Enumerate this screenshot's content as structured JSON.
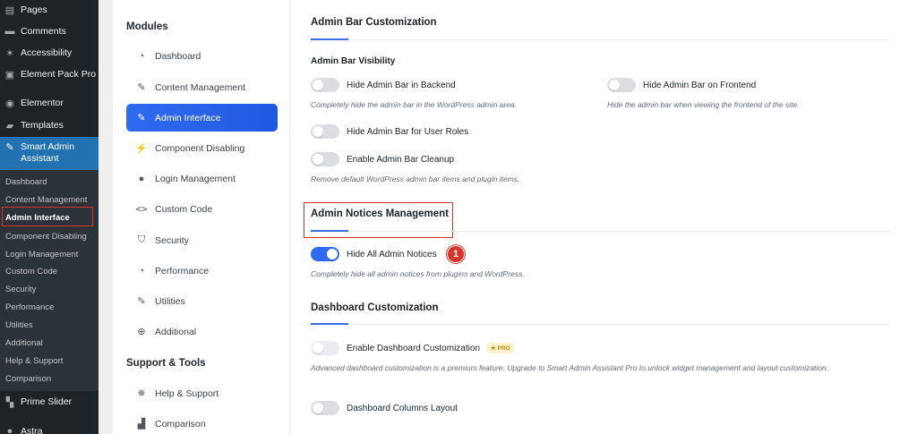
{
  "wp_menu": {
    "items": [
      {
        "label": "Pages",
        "icon": "pages-icon"
      },
      {
        "label": "Comments",
        "icon": "comments-icon"
      },
      {
        "label": "Accessibility",
        "icon": "accessibility-icon"
      },
      {
        "label": "Element Pack Pro",
        "icon": "element-pack-icon"
      },
      {
        "label": "Elementor",
        "icon": "elementor-icon"
      },
      {
        "label": "Templates",
        "icon": "folder-icon"
      },
      {
        "label": "Smart Admin Assistant",
        "icon": "wrench-icon"
      },
      {
        "label": "Prime Slider",
        "icon": "slider-icon"
      },
      {
        "label": "Astra",
        "icon": "astra-icon"
      }
    ],
    "submenu": [
      "Dashboard",
      "Content Management",
      "Admin Interface",
      "Component Disabling",
      "Login Management",
      "Custom Code",
      "Security",
      "Performance",
      "Utilities",
      "Additional",
      "Help & Support",
      "Comparison"
    ]
  },
  "modules_nav": {
    "modules_heading": "Modules",
    "modules": [
      {
        "label": "Dashboard",
        "icon": "dashboard-gauge-icon"
      },
      {
        "label": "Content Management",
        "icon": "pin-icon"
      },
      {
        "label": "Admin Interface",
        "icon": "pin-icon"
      },
      {
        "label": "Component Disabling",
        "icon": "plug-icon"
      },
      {
        "label": "Login Management",
        "icon": "user-icon"
      },
      {
        "label": "Custom Code",
        "icon": "code-icon"
      },
      {
        "label": "Security",
        "icon": "shield-icon"
      },
      {
        "label": "Performance",
        "icon": "gauge-icon"
      },
      {
        "label": "Utilities",
        "icon": "wrench-icon"
      },
      {
        "label": "Additional",
        "icon": "plus-circle-icon"
      }
    ],
    "support_heading": "Support & Tools",
    "support": [
      {
        "label": "Help & Support",
        "icon": "lifebuoy-icon"
      },
      {
        "label": "Comparison",
        "icon": "bar-chart-icon"
      }
    ]
  },
  "main": {
    "admin_bar": {
      "title": "Admin Bar Customization",
      "visibility_heading": "Admin Bar Visibility",
      "hide_backend_label": "Hide Admin Bar in Backend",
      "hide_backend_desc": "Completely hide the admin bar in the WordPress admin area.",
      "hide_frontend_label": "Hide Admin Bar on Frontend",
      "hide_frontend_desc": "Hide the admin bar when viewing the frontend of the site.",
      "hide_roles_label": "Hide Admin Bar for User Roles",
      "cleanup_label": "Enable Admin Bar Cleanup",
      "cleanup_desc": "Remove default WordPress admin bar items and plugin items."
    },
    "notices": {
      "title": "Admin Notices Management",
      "hide_all_label": "Hide All Admin Notices",
      "hide_all_desc": "Completely hide all admin notices from plugins and WordPress.",
      "hide_all_enabled": true,
      "step_badge": "1"
    },
    "dashboard": {
      "title": "Dashboard Customization",
      "enable_label": "Enable Dashboard Customization",
      "pro_badge": "★ PRO",
      "enable_desc": "Advanced dashboard customization is a premium feature. Upgrade to Smart Admin Assistant Pro to unlock widget management and layout customization.",
      "columns_label": "Dashboard Columns Layout"
    }
  },
  "colors": {
    "accent": "#2f6bf0",
    "wp_sidebar": "#1d2327",
    "wp_active": "#2271b1",
    "highlight_red": "#d9342b"
  }
}
